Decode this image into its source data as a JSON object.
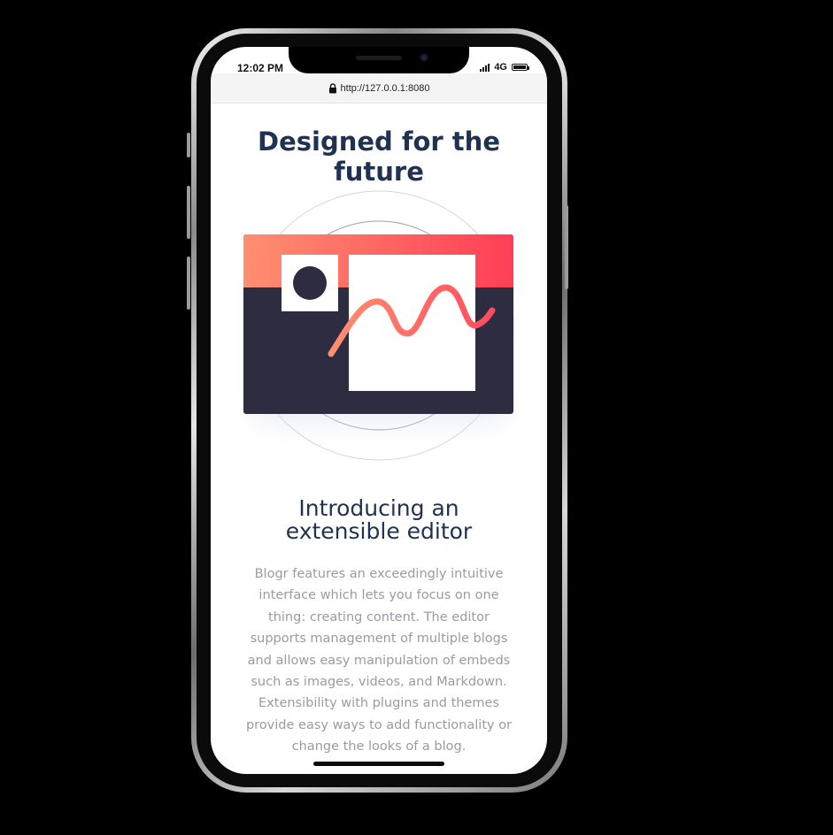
{
  "status_bar": {
    "time": "12:02 PM",
    "network": "4G",
    "icons": [
      "signal-icon",
      "battery-icon"
    ]
  },
  "browser": {
    "url": "http://127.0.0.1:8080",
    "icons": [
      "lock-icon"
    ]
  },
  "page": {
    "heading": "Designed for the future",
    "illustration_icon": "editor-illustration-icon",
    "subheading": "Introducing an extensible editor",
    "description": "Blogr features an exceedingly intuitive interface which lets you focus on one thing: creating content. The editor supports management of multiple blogs and allows easy manipulation of embeds such as images, videos, and Markdown. Extensibility with plugins and themes provide easy ways to add functionality or change the looks of a blog."
  },
  "colors": {
    "heading": "#1f3251",
    "body_text": "#9a9aa2",
    "gradient_start": "#ff8f71",
    "gradient_end": "#ff3e55",
    "dark_panel": "#2c2c40"
  }
}
